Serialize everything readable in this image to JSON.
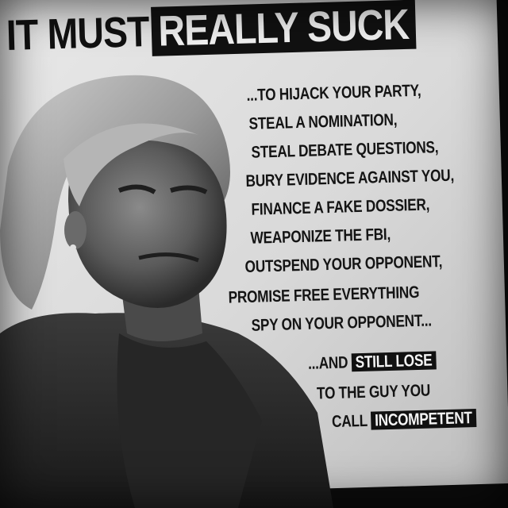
{
  "headline": {
    "plain": "IT MUST",
    "boxed": "REALLY SUCK"
  },
  "list_lines": [
    "...TO HIJACK YOUR PARTY,",
    "STEAL A NOMINATION,",
    "STEAL DEBATE QUESTIONS,",
    "BURY EVIDENCE AGAINST YOU,",
    "FINANCE A FAKE DOSSIER,",
    "WEAPONIZE THE FBI,",
    "OUTSPEND YOUR OPPONENT,",
    "PROMISE FREE EVERYTHING",
    "SPY ON YOUR OPPONENT..."
  ],
  "closing": {
    "line1_prefix": "...AND",
    "line1_highlight": "STILL LOSE",
    "line2": "TO THE GUY YOU",
    "line3_prefix": "CALL",
    "line3_highlight": "INCOMPETENT"
  },
  "colors": {
    "ink": "#111111",
    "paper": "#e4e4e4",
    "highlight_text": "#f4f4f4"
  }
}
